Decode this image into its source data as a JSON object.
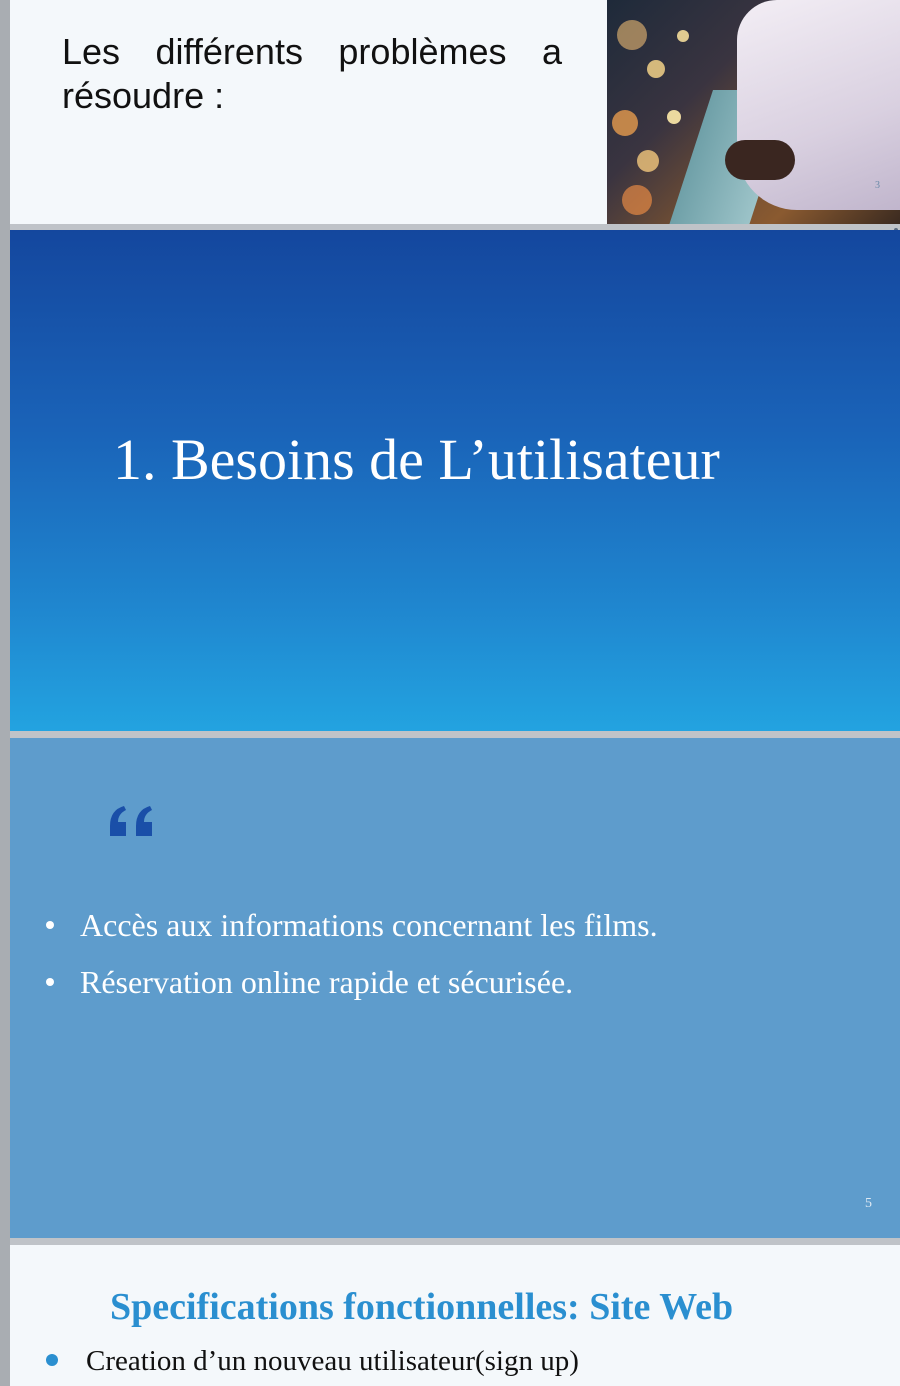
{
  "slide1": {
    "heading": "Les différents problèmes a résoudre :",
    "photo_page_number": "3"
  },
  "slide2": {
    "title": "1. Besoins de L’utilisateur"
  },
  "slide3": {
    "quote_icon": "quote-icon",
    "bullets": [
      "Accès aux informations concernant les films.",
      "Réservation online rapide et sécurisée."
    ],
    "page_number": "5"
  },
  "slide4": {
    "title": "Specifications fonctionnelles: Site Web",
    "item": "Creation d’un nouveau utilisateur(sign up)"
  },
  "colors": {
    "slide2_top": "#14479e",
    "slide2_bottom": "#23a3e0",
    "slide3_bg": "#5e9ccc",
    "accent": "#2a8fd0",
    "quote": "#1a4fa8"
  }
}
